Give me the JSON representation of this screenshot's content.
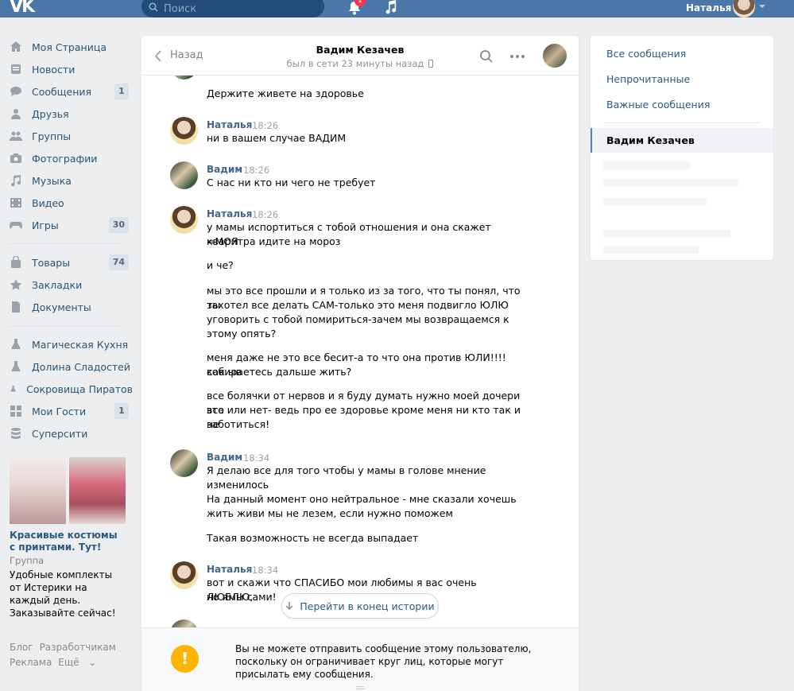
{
  "topbar": {
    "logo": "VK",
    "search_placeholder": "Поиск",
    "notifications_count": "1",
    "user_name": "Наталья"
  },
  "nav": {
    "items": [
      {
        "label": "Моя Страница",
        "icon": "house-icon"
      },
      {
        "label": "Новости",
        "icon": "news-icon"
      },
      {
        "label": "Сообщения",
        "icon": "messages-icon",
        "count": "1"
      },
      {
        "label": "Друзья",
        "icon": "person-icon"
      },
      {
        "label": "Группы",
        "icon": "group-icon"
      },
      {
        "label": "Фотографии",
        "icon": "camera-icon"
      },
      {
        "label": "Музыка",
        "icon": "music-note-icon"
      },
      {
        "label": "Видео",
        "icon": "film-icon"
      },
      {
        "label": "Игры",
        "icon": "gamepad-icon",
        "count": "30"
      },
      {
        "label": "Товары",
        "icon": "bag-icon",
        "count": "74"
      },
      {
        "label": "Закладки",
        "icon": "star-icon"
      },
      {
        "label": "Документы",
        "icon": "document-icon"
      },
      {
        "label": "Магическая Кухня",
        "icon": "flask-icon"
      },
      {
        "label": "Долина Сладостей",
        "icon": "flask-icon"
      },
      {
        "label": "Сокровища Пиратов",
        "icon": "flask-icon"
      },
      {
        "label": "Мои Гости",
        "icon": "grid-icon",
        "count": "1"
      },
      {
        "label": "Суперсити",
        "icon": "database-icon"
      }
    ]
  },
  "ad": {
    "title": "Красивые костюмы с принтами. Тут!",
    "type": "Группа",
    "description": "Удобные комплекты от Истерики на каждый день. Заказывайте сейчас!"
  },
  "footer": {
    "blog": "Блог",
    "developers": "Разработчикам",
    "ads": "Реклама",
    "more": "Ещё"
  },
  "chat": {
    "back_label": "Назад",
    "contact_name": "Вадим Кезачев",
    "status": "был в сети 23 минуты назад",
    "messages": [
      {
        "text": "Держите живете на здоровье"
      },
      {
        "author": "Наталья",
        "time": "18:26",
        "lines": [
          "ни в вашем случае ВАДИМ"
        ]
      },
      {
        "author": "Вадим",
        "time": "18:26",
        "lines": [
          "С нас ни кто ни чего не требует"
        ]
      },
      {
        "author": "Наталья",
        "time": "18:26",
        "lines": [
          "у мамы испортиться с тобой отношения и она скажет =МОЯ",
          "кваритра идите на мороз",
          "и че?",
          "мы это все прошли и я только из за того, что ты понял, что ты",
          "захотел все делать САМ-только это меня подвигло ЮЛЮ",
          "уговорить с тобой помириться-зачем мы возвращаемся к",
          "этому опять?",
          "меня даже не это все бесит-а то что она против ЮЛИ!!!! как ыв",
          "собираетесь дальше жить?",
          "все болячки от нервов и я буду думать нужно моей дочери все",
          "это или нет- ведь про ее здоровье кроме меня ни кто так и не",
          "заботиться!"
        ]
      },
      {
        "author": "Вадим",
        "time": "18:34",
        "lines": [
          "Я делаю все для того чтобы у мамы в голове мнение",
          "изменилось",
          "На данный момент оно нейтральное - мне сказали хочешь",
          "жить живи мы не лезем, если нужно поможем",
          "Такая возможность не всегда выпадает"
        ]
      },
      {
        "author": "Наталья",
        "time": "18:34",
        "lines": [
          "вот и скажи что СПАСИБО мои любимы я вас очень ЛЮБЛЮ,",
          "но ямы сами!"
        ]
      }
    ],
    "scroll_button": "Перейти в конец истории",
    "notice": "Вы не можете отправить сообщение этому пользователю, поскольку он ограничивает круг лиц, которые могут присылать ему сообщения."
  },
  "right_panel": {
    "all": "Все сообщения",
    "unread": "Непрочитанные",
    "important": "Важные сообщения",
    "active_chat": "Вадим Кезачев"
  },
  "colors": {
    "header": "#4a76a8",
    "link": "#2a5885",
    "author": "#42648b",
    "warning": "#ffb302",
    "badge": "#ff3347"
  }
}
